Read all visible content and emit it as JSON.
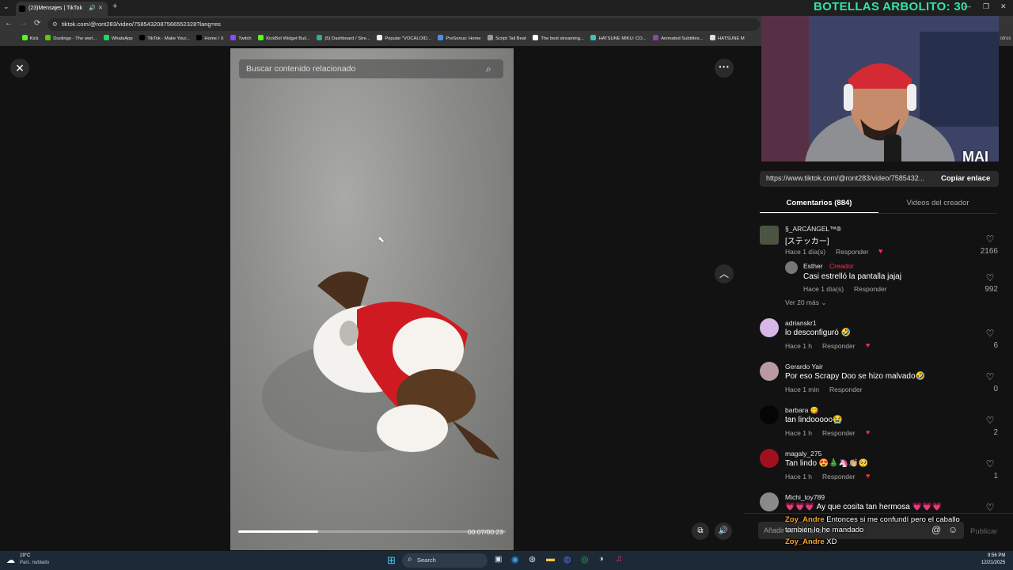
{
  "browser": {
    "tab_title": "(23)Mensajes | TikTok",
    "url": "tiktok.com/@ront283/video/7585432087566552328?lang=es",
    "bookmarks": [
      "Kick",
      "Duolingo - The worl...",
      "WhatsApp",
      "TikTok - Make Your...",
      "Home / X",
      "Twitch",
      "KickBot Widget Buil...",
      "(5) Dashboard / Stre...",
      "Popular \"VOCALOID...",
      "PreSonus: Home",
      "Script Tail Beat",
      "The best streaming...",
      "HATSUNE MIKU: CO...",
      "Animated Subtitles...",
      "HATSUNE M"
    ],
    "overflow_label": "otros"
  },
  "stream_overlay": {
    "title": "BOTELLAS ARBOLITO: 30",
    "watermark": "MAI"
  },
  "video": {
    "search_placeholder": "Buscar contenido relacionado",
    "time": "00:07/00:23",
    "progress": 0.3
  },
  "share": {
    "link": "https://www.tiktok.com/@ront283/video/7585432...",
    "copy_label": "Copiar enlace"
  },
  "tabs": {
    "comments": "Comentarios (884)",
    "creator_videos": "Videos del creador"
  },
  "comments": [
    {
      "name": "§_ARCÁNGEL™®",
      "text": "[ステッカー]",
      "meta": "Hace 1 día(s)",
      "reply": "Responder",
      "likes": "2166"
    },
    {
      "name": "adrianskr1",
      "text": "lo desconfiguró 🤣",
      "meta": "Hace 1 h",
      "reply": "Responder",
      "likes": "6"
    },
    {
      "name": "Gerardo Yair",
      "text": "Por eso Scrapy Doo se hizo malvado🤣",
      "meta": "Hace 1 min",
      "reply": "Responder",
      "likes": "0"
    },
    {
      "name": "barbara 😋",
      "text": "tan lindooooo😭",
      "meta": "Hace 1 h",
      "reply": "Responder",
      "likes": "2"
    },
    {
      "name": "magaly_275",
      "text": "Tan lindo 😍🎄🦄👏🏼🥺",
      "meta": "Hace 1 h",
      "reply": "Responder",
      "likes": "1"
    },
    {
      "name": "Michi_toy789",
      "text": "💗💗💗 Ay que cosita tan hermosa 💗💗💗",
      "meta": "",
      "reply": "",
      "likes": ""
    }
  ],
  "reply": {
    "name": "Esther",
    "badge": "Creador",
    "text": "Casi estrelló la pantalla jajaj",
    "meta": "Hace 1 día(s)",
    "reply": "Responder",
    "likes": "992",
    "more": "Ver 20 más"
  },
  "composer": {
    "placeholder": "Añadir comentario...",
    "publish": "Publicar"
  },
  "chat": [
    {
      "user": "Zoy_Andre",
      "msg": "Entonces si me confundí pero el caballo también lo he mandado"
    },
    {
      "user": "Zoy_Andre",
      "msg": "XD"
    }
  ],
  "taskbar": {
    "weather_temp": "19°C",
    "weather_desc": "Parc. nublado",
    "search": "Search",
    "time": "9:56 PM",
    "date": "12/21/2025"
  },
  "colors": {
    "accent": "#fe2c55",
    "chat_user": "#f5a623",
    "overlay_title": "#2ee6a6"
  }
}
